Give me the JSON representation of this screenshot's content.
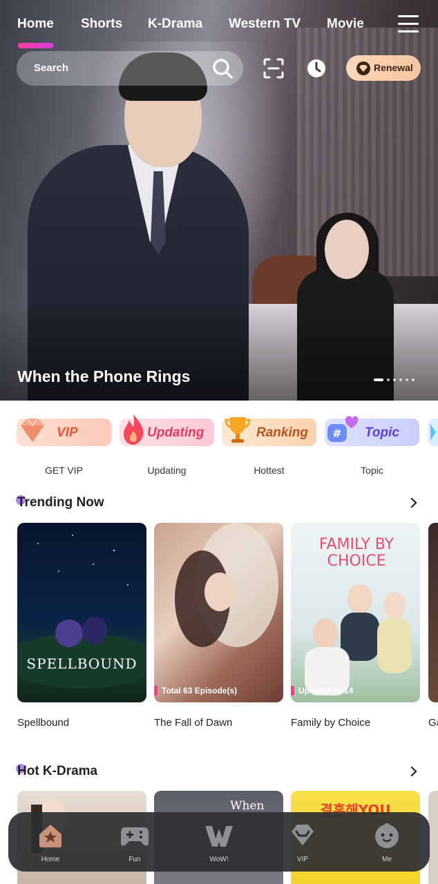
{
  "nav": {
    "tabs": [
      {
        "label": "Home",
        "active": true
      },
      {
        "label": "Shorts"
      },
      {
        "label": "K-Drama"
      },
      {
        "label": "Western TV"
      },
      {
        "label": "Movie"
      }
    ],
    "menu_icon": "hamburger-menu-icon"
  },
  "search": {
    "placeholder": "Search",
    "icon": "search-icon"
  },
  "toolbar": {
    "scan_icon": "scan-icon",
    "history_icon": "history-clock-icon",
    "renewal_label": "Renewal",
    "renewal_color": "#f9d0b0"
  },
  "hero": {
    "title": "When the Phone Rings",
    "slide_count": 6,
    "active_slide": 1
  },
  "categories": [
    {
      "pill": "VIP",
      "caption": "GET VIP",
      "icon": "diamond-icon",
      "color": "#e4553d"
    },
    {
      "pill": "Updating",
      "caption": "Updating",
      "icon": "flame-icon",
      "color": "#e13a63"
    },
    {
      "pill": "Ranking",
      "caption": "Hottest",
      "icon": "trophy-icon",
      "color": "#b85420"
    },
    {
      "pill": "Topic",
      "caption": "Topic",
      "icon": "hashtag-heart-icon",
      "color": "#5b3fd6"
    }
  ],
  "trending": {
    "title": "Trending Now",
    "items": [
      {
        "title": "Spellbound",
        "badge": "",
        "poster_text": "SPELLBOUND"
      },
      {
        "title": "The Fall of Dawn",
        "badge": "Total 63 Episode(s)",
        "poster_text": ""
      },
      {
        "title": "Family by Choice",
        "badge": "Updated to 14",
        "poster_text": "FAMILY BY CHOICE"
      },
      {
        "title": "Ga",
        "badge": "",
        "poster_text": ""
      }
    ]
  },
  "hot_kdrama": {
    "title": "Hot K-Drama",
    "poster_texts": [
      "",
      "When",
      "결혼해YOU",
      ""
    ]
  },
  "bottom_nav": [
    {
      "label": "Home",
      "icon": "home-icon",
      "active": true
    },
    {
      "label": "Fun",
      "icon": "gamepad-icon"
    },
    {
      "label": "WoW!",
      "icon": "wow-logo-icon"
    },
    {
      "label": "VIP",
      "icon": "vip-diamond-icon"
    },
    {
      "label": "Me",
      "icon": "profile-face-icon"
    }
  ]
}
